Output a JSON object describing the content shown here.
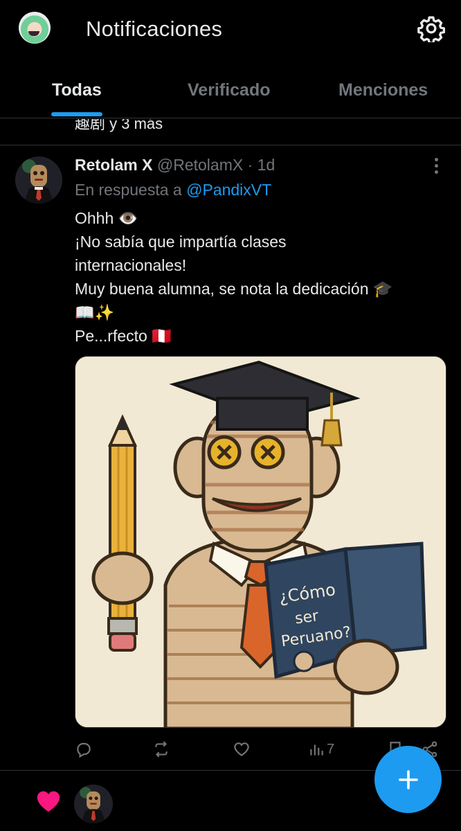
{
  "header": {
    "title": "Notificaciones",
    "settings_icon": "gear-icon"
  },
  "tabs": [
    {
      "label": "Todas",
      "active": true
    },
    {
      "label": "Verificado",
      "active": false
    },
    {
      "label": "Menciones",
      "active": false
    }
  ],
  "previous_snippet": "趣剧 y 3 más",
  "post": {
    "author_name": "Retolam X",
    "author_handle": "@RetolamX",
    "separator": "·",
    "time": "1d",
    "reply_label": "En respuesta a",
    "reply_to": "@PandixVT",
    "lines": [
      "Ohhh 👁️",
      "¡No sabía que impartía clases",
      "internacionales!",
      "Muy buena alumna, se nota la dedicación 🎓",
      "📖✨",
      "Pe...rfecto 🇵🇪"
    ],
    "image_text": {
      "book_line1": "¿Cómo",
      "book_line2": "ser",
      "book_line3": "Peruano?"
    },
    "stats": {
      "views": "7"
    }
  },
  "fab_icon": "plus-icon",
  "colors": {
    "accent": "#1d9bf0",
    "background": "#000000",
    "text_primary": "#e7e9ea",
    "text_secondary": "#71767b",
    "like_pink": "#f91880"
  }
}
